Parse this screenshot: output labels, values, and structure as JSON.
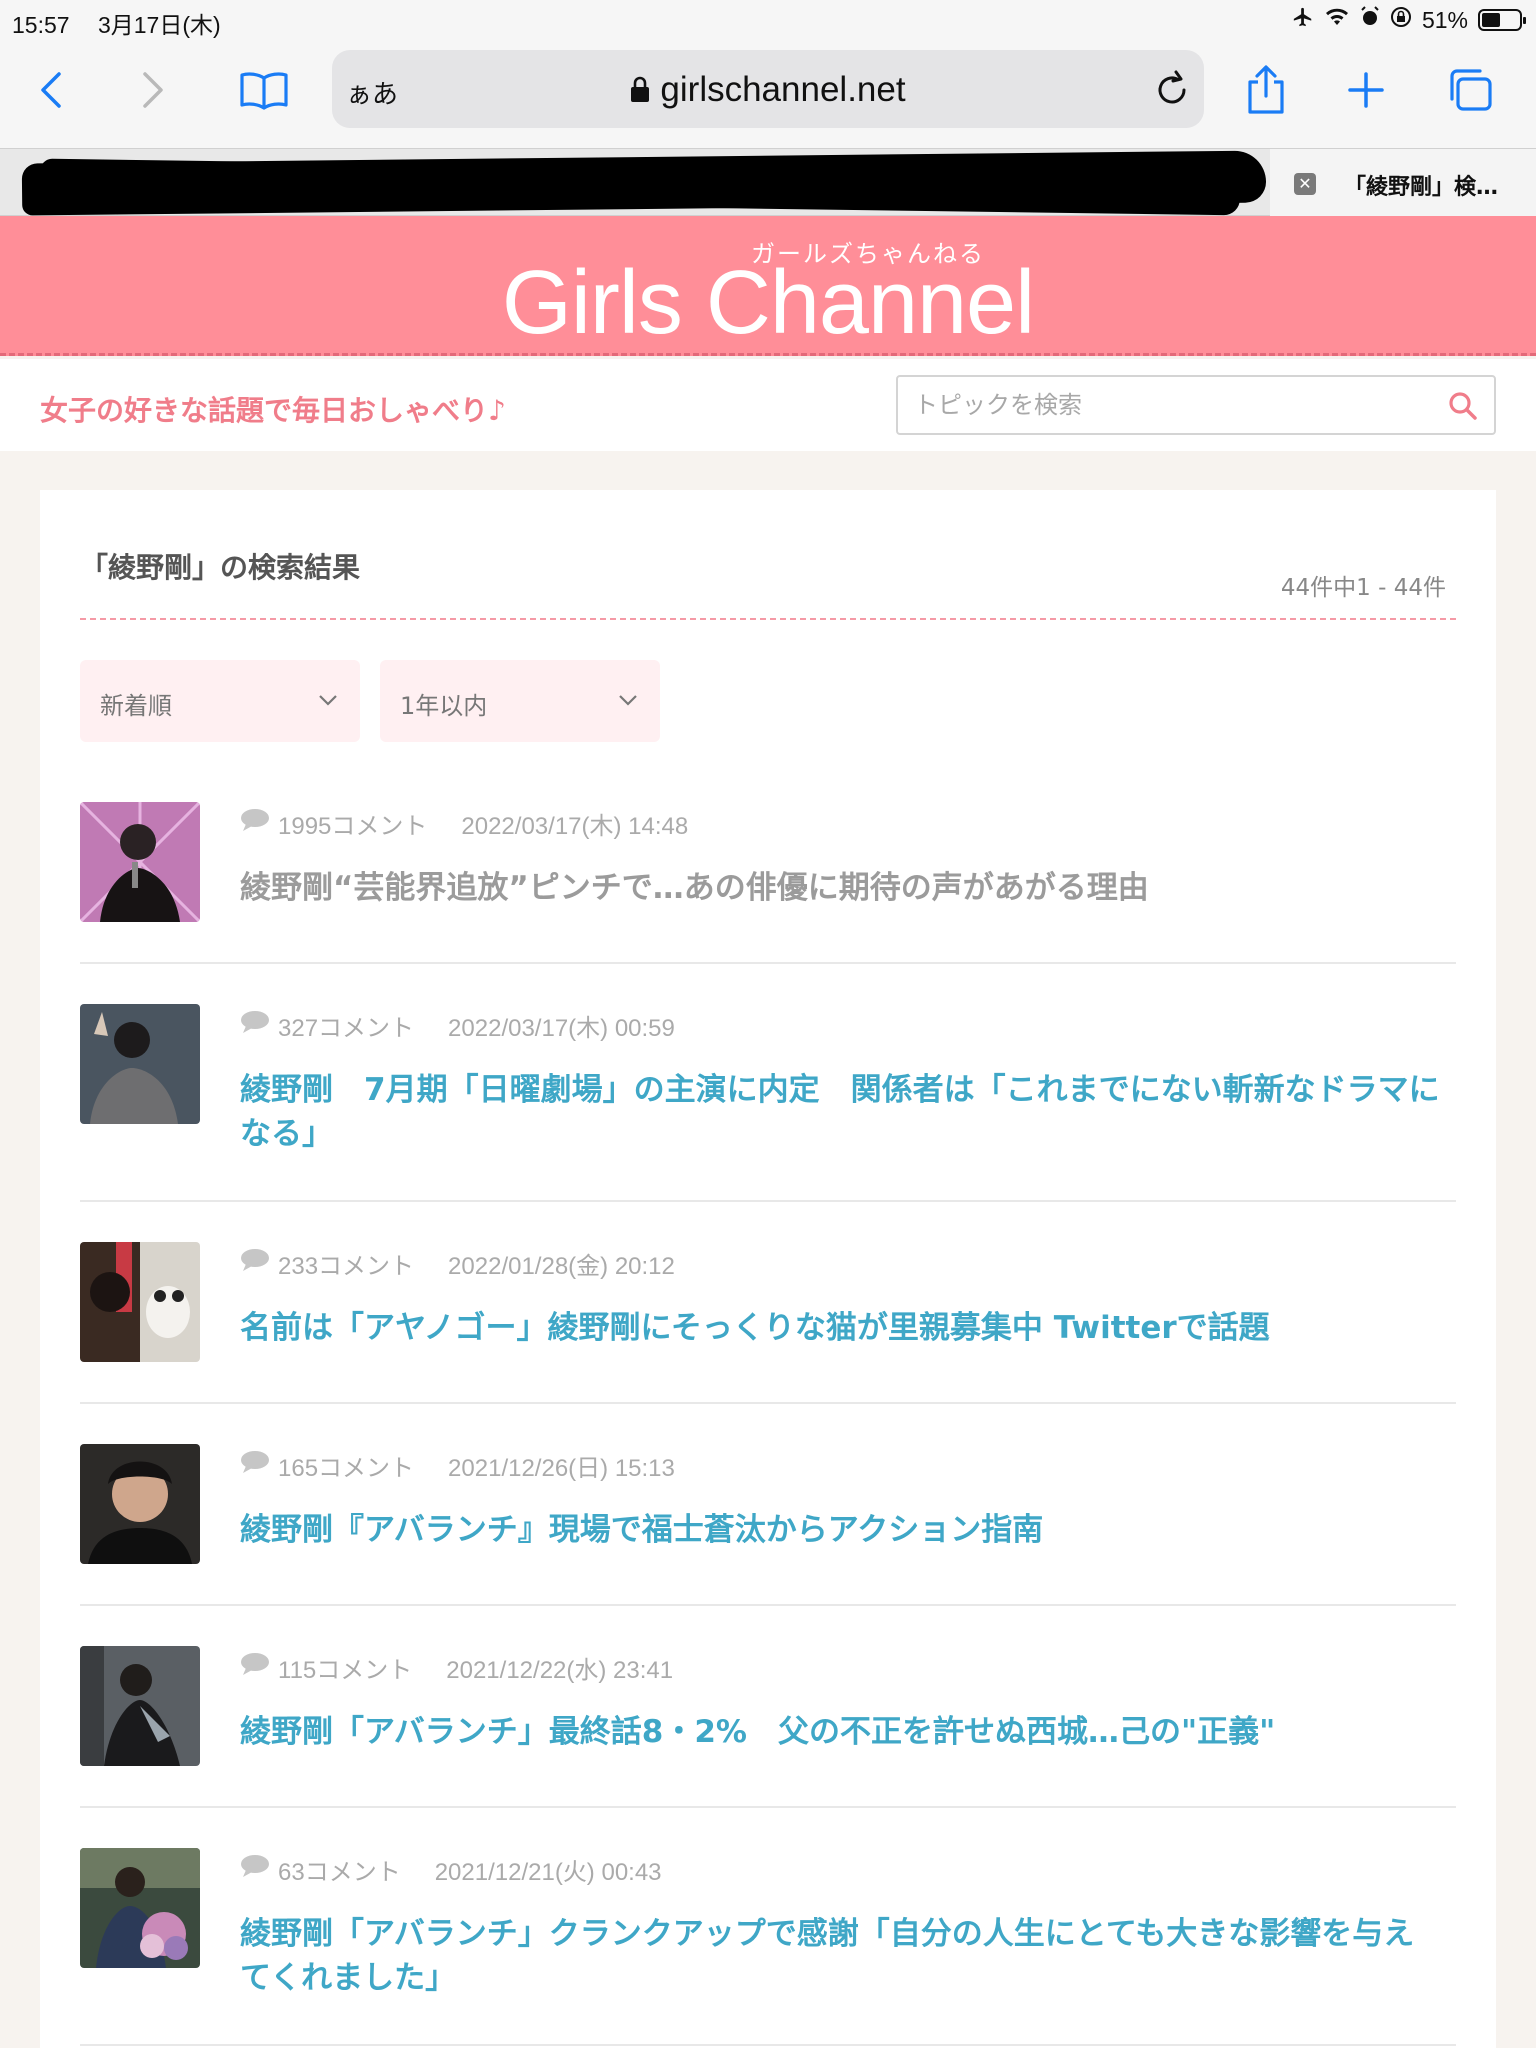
{
  "status": {
    "time": "15:57",
    "date": "3月17日(木)",
    "battery_text": "51%",
    "battery_level": 0.51
  },
  "browser": {
    "aa_label": "ぁあ",
    "url": "girlschannel.net",
    "active_tab_title": "「綾野剛」検…"
  },
  "site": {
    "logo_kana": "ガールズちゃんねる",
    "logo": "Girls Channel",
    "tagline": "女子の好きな話題で毎日おしゃべり♪",
    "search_placeholder": "トピックを検索",
    "colors": {
      "header": "#ff8e98",
      "link": "#3fa7c7",
      "visited": "#9b9b9b",
      "tagline": "#f07d8a"
    }
  },
  "results": {
    "title": "「綾野剛」の検索結果",
    "count": "44件中1 - 44件",
    "sort_selected": "新着順",
    "period_selected": "1年以内",
    "items": [
      {
        "comments": "1995コメント",
        "date": "2022/03/17(木) 14:48",
        "title": "綾野剛“芸能界追放”ピンチで…あの俳優に期待の声があがる理由",
        "visited": true
      },
      {
        "comments": "327コメント",
        "date": "2022/03/17(木) 00:59",
        "title": "綾野剛　7月期「日曜劇場」の主演に内定　関係者は「これまでにない斬新なドラマになる」",
        "visited": false
      },
      {
        "comments": "233コメント",
        "date": "2022/01/28(金) 20:12",
        "title": "名前は「アヤノゴー」綾野剛にそっくりな猫が里親募集中 Twitterで話題",
        "visited": false
      },
      {
        "comments": "165コメント",
        "date": "2021/12/26(日) 15:13",
        "title": "綾野剛『アバランチ』現場で福士蒼汰からアクション指南",
        "visited": false
      },
      {
        "comments": "115コメント",
        "date": "2021/12/22(水) 23:41",
        "title": "綾野剛「アバランチ」最終話8・2%　父の不正を許せぬ西城…己の\"正義\"",
        "visited": false
      },
      {
        "comments": "63コメント",
        "date": "2021/12/21(火) 00:43",
        "title": "綾野剛「アバランチ」クランクアップで感謝「自分の人生にとても大きな影響を与えてくれました」",
        "visited": false
      }
    ]
  }
}
